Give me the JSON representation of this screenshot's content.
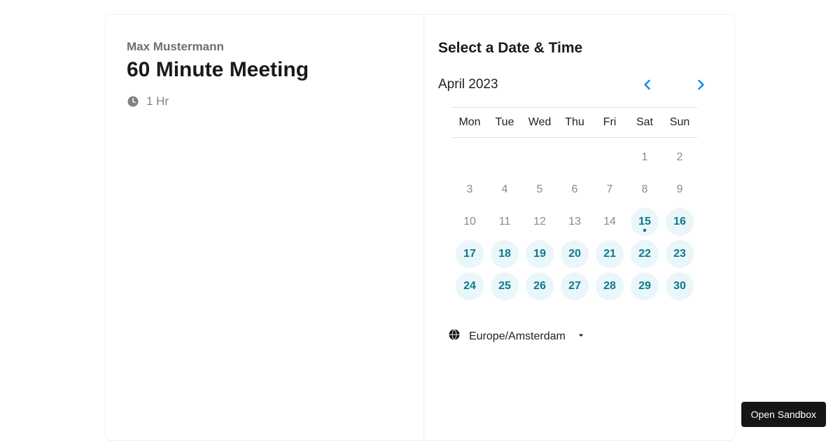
{
  "meeting": {
    "organizer": "Max Mustermann",
    "title": "60 Minute Meeting",
    "duration_label": "1 Hr"
  },
  "right": {
    "heading": "Select a Date & Time",
    "month_label": "April 2023",
    "timezone": "Europe/Amsterdam"
  },
  "weekdays": [
    "Mon",
    "Tue",
    "Wed",
    "Thu",
    "Fri",
    "Sat",
    "Sun"
  ],
  "leading_blanks": 5,
  "days": [
    {
      "n": 1,
      "available": false,
      "today": false
    },
    {
      "n": 2,
      "available": false,
      "today": false
    },
    {
      "n": 3,
      "available": false,
      "today": false
    },
    {
      "n": 4,
      "available": false,
      "today": false
    },
    {
      "n": 5,
      "available": false,
      "today": false
    },
    {
      "n": 6,
      "available": false,
      "today": false
    },
    {
      "n": 7,
      "available": false,
      "today": false
    },
    {
      "n": 8,
      "available": false,
      "today": false
    },
    {
      "n": 9,
      "available": false,
      "today": false
    },
    {
      "n": 10,
      "available": false,
      "today": false
    },
    {
      "n": 11,
      "available": false,
      "today": false
    },
    {
      "n": 12,
      "available": false,
      "today": false
    },
    {
      "n": 13,
      "available": false,
      "today": false
    },
    {
      "n": 14,
      "available": false,
      "today": false
    },
    {
      "n": 15,
      "available": true,
      "today": true
    },
    {
      "n": 16,
      "available": true,
      "today": false
    },
    {
      "n": 17,
      "available": true,
      "today": false
    },
    {
      "n": 18,
      "available": true,
      "today": false
    },
    {
      "n": 19,
      "available": true,
      "today": false
    },
    {
      "n": 20,
      "available": true,
      "today": false
    },
    {
      "n": 21,
      "available": true,
      "today": false
    },
    {
      "n": 22,
      "available": true,
      "today": false
    },
    {
      "n": 23,
      "available": true,
      "today": false
    },
    {
      "n": 24,
      "available": true,
      "today": false
    },
    {
      "n": 25,
      "available": true,
      "today": false
    },
    {
      "n": 26,
      "available": true,
      "today": false
    },
    {
      "n": 27,
      "available": true,
      "today": false
    },
    {
      "n": 28,
      "available": true,
      "today": false
    },
    {
      "n": 29,
      "available": true,
      "today": false
    },
    {
      "n": 30,
      "available": true,
      "today": false
    }
  ],
  "sandbox_button": "Open Sandbox"
}
